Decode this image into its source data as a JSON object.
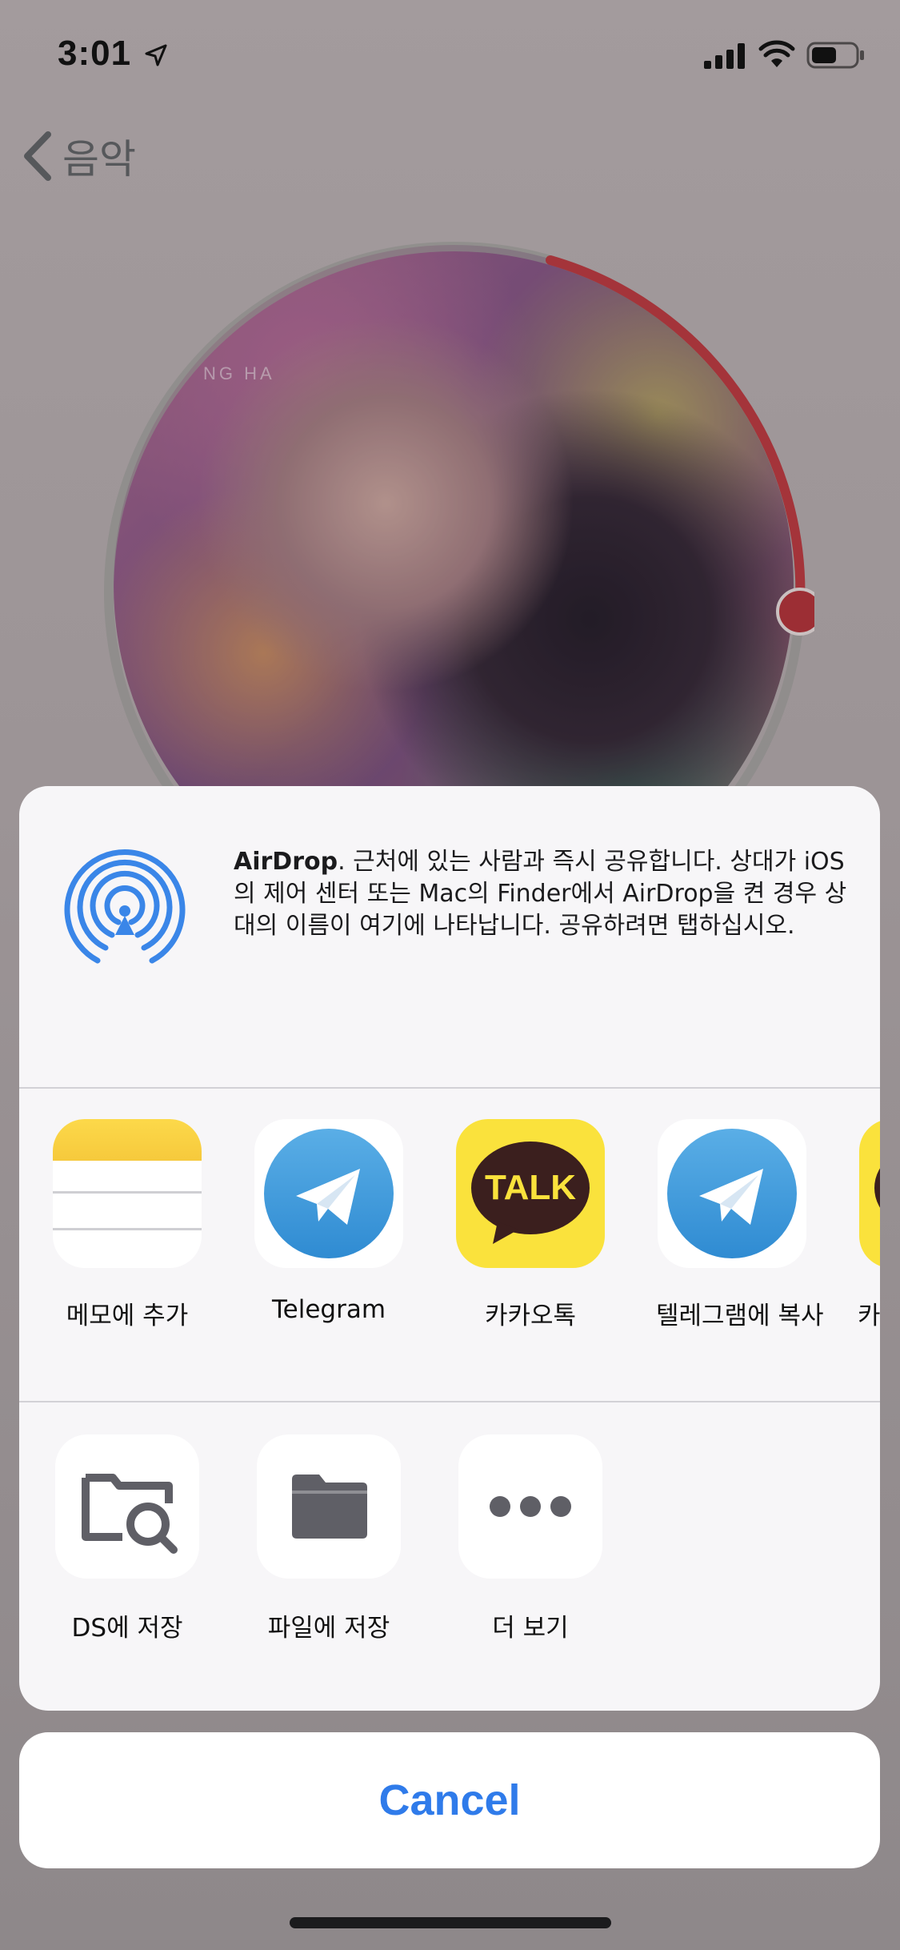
{
  "status_bar": {
    "time": "3:01",
    "icons": [
      "location-arrow-icon",
      "cellular-signal-icon",
      "wifi-icon",
      "battery-icon"
    ]
  },
  "nav": {
    "back_label": "음악"
  },
  "album": {
    "cover_text": "NG HA",
    "progress_color": "#b03a40"
  },
  "share_sheet": {
    "airdrop": {
      "title": "AirDrop",
      "description": ". 근처에 있는 사람과 즉시 공유합니다. 상대가 iOS의 제어 센터 또는 Mac의 Finder에서 AirDrop을 켠 경우 상대의 이름이 여기에 나타납니다. 공유하려면 탭하십시오."
    },
    "apps": [
      {
        "label": "메모에 추가",
        "icon": "notes-icon"
      },
      {
        "label": "Telegram",
        "icon": "telegram-icon"
      },
      {
        "label": "카카오톡",
        "icon": "kakaotalk-icon",
        "icon_text": "TALK"
      },
      {
        "label": "텔레그램에 복사",
        "icon": "telegram-icon"
      },
      {
        "label": "카카",
        "icon": "kakaotalk-icon"
      }
    ],
    "actions": [
      {
        "label": "DS에 저장",
        "icon": "folder-search-icon"
      },
      {
        "label": "파일에 저장",
        "icon": "folder-icon"
      },
      {
        "label": "더 보기",
        "icon": "more-icon"
      }
    ],
    "cancel_label": "Cancel"
  },
  "colors": {
    "accent": "#2f7bea",
    "airdrop_blue": "#3a86e8",
    "kakao_yellow": "#fae23c",
    "telegram_blue": "#3a95dd"
  }
}
